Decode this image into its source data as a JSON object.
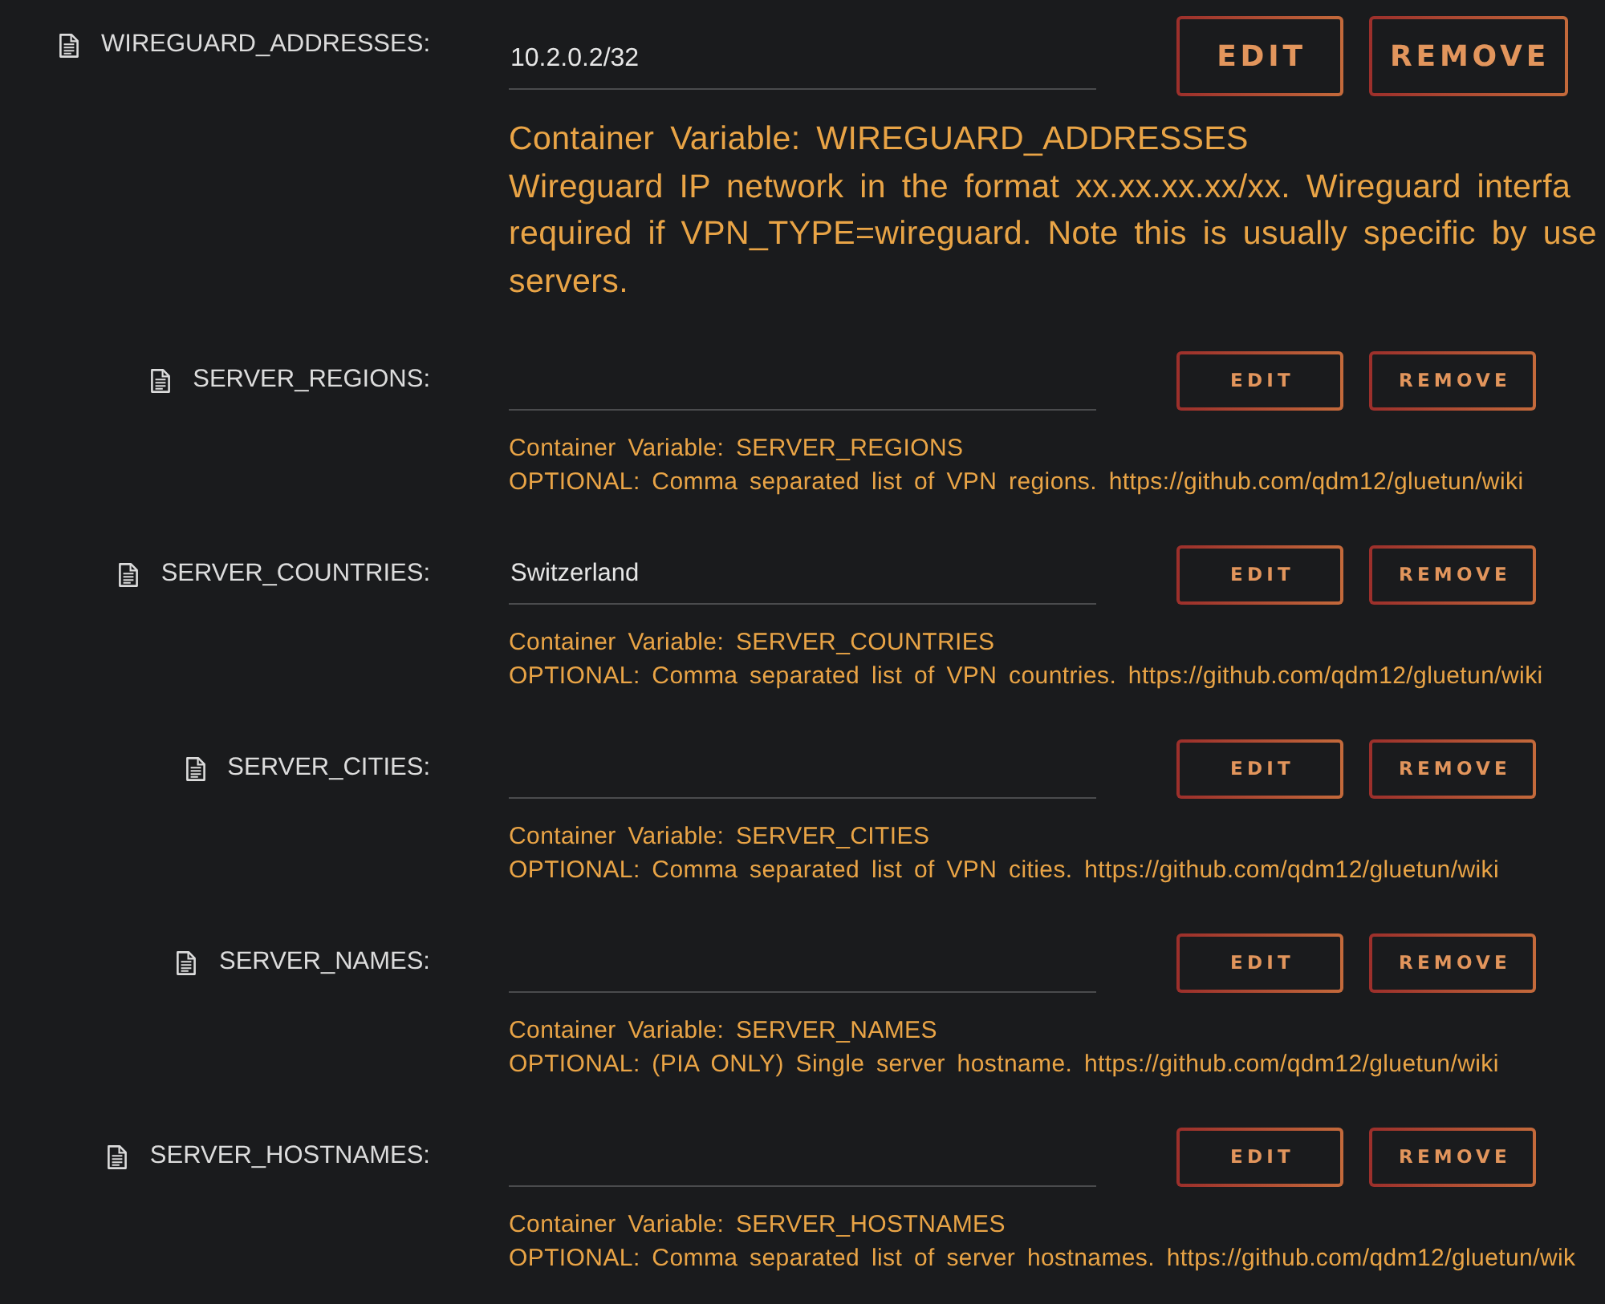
{
  "variables": [
    {
      "kind": "large",
      "name": "WIREGUARD_ADDRESSES:",
      "value": "10.2.0.2/32",
      "buttons": [
        "EDIT",
        "REMOVE"
      ],
      "description": [
        "Container Variable: WIREGUARD_ADDRESSES",
        "Wireguard IP network in the format xx.xx.xx.xx/xx. Wireguard interfa",
        "required if VPN_TYPE=wireguard. Note this is usually specific by use",
        "servers."
      ]
    },
    {
      "kind": "standard",
      "name": "SERVER_REGIONS:",
      "buttons": [
        "EDIT",
        "REMOVE"
      ],
      "description": [
        "Container Variable: SERVER_REGIONS",
        "OPTIONAL: Comma separated list of VPN regions. https://github.com/qdm12/gluetun/wiki"
      ]
    },
    {
      "kind": "standard",
      "name": "SERVER_COUNTRIES:",
      "value": "Switzerland",
      "buttons": [
        "EDIT",
        "REMOVE"
      ],
      "description": [
        "Container Variable: SERVER_COUNTRIES",
        "OPTIONAL: Comma separated list of VPN countries. https://github.com/qdm12/gluetun/wiki"
      ]
    },
    {
      "kind": "standard",
      "name": "SERVER_CITIES:",
      "buttons": [
        "EDIT",
        "REMOVE"
      ],
      "description": [
        "Container Variable: SERVER_CITIES",
        "OPTIONAL: Comma separated list of VPN cities. https://github.com/qdm12/gluetun/wiki"
      ]
    },
    {
      "kind": "standard",
      "name": "SERVER_NAMES:",
      "buttons": [
        "EDIT",
        "REMOVE"
      ],
      "description": [
        "Container Variable: SERVER_NAMES",
        "OPTIONAL: (PIA ONLY) Single server hostname. https://github.com/qdm12/gluetun/wiki"
      ]
    },
    {
      "kind": "standard",
      "name": "SERVER_HOSTNAMES:",
      "buttons": [
        "EDIT",
        "REMOVE"
      ],
      "description": [
        "Container Variable: SERVER_HOSTNAMES",
        "OPTIONAL: Comma separated list of server hostnames. https://github.com/qdm12/gluetun/wik"
      ]
    }
  ]
}
